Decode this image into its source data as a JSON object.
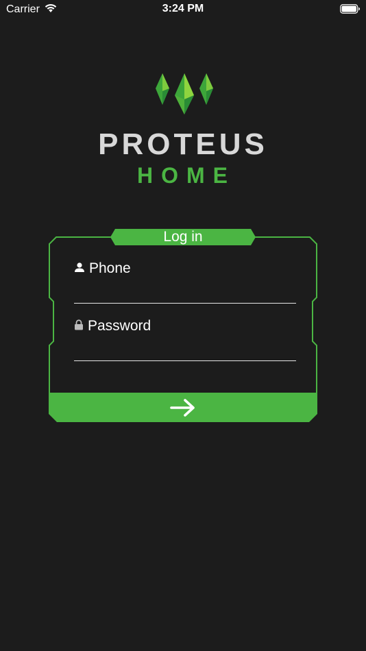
{
  "status_bar": {
    "carrier": "Carrier",
    "time": "3:24 PM"
  },
  "logo": {
    "title": "PROTEUS",
    "subtitle": "HOME"
  },
  "login": {
    "title": "Log in",
    "phone_label": "Phone",
    "phone_value": "",
    "password_label": "Password",
    "password_value": ""
  },
  "icons": {
    "user": "user-icon",
    "lock": "lock-icon",
    "submit": "arrow-right-icon",
    "wifi": "wifi-icon",
    "battery": "battery-icon"
  },
  "colors": {
    "background": "#1c1c1c",
    "accent": "#4bb543",
    "logo_title": "#d8d8d8",
    "text": "#ffffff"
  }
}
